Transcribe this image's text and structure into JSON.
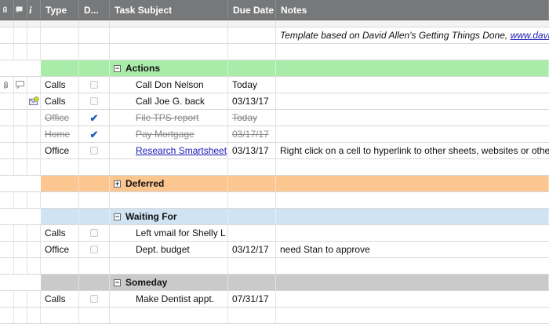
{
  "header": {
    "attachment_icon": "paperclip-icon",
    "comment_icon": "comment-icon",
    "info_label": "i",
    "type": "Type",
    "done": "D...",
    "subject": "Task Subject",
    "due": "Due Date",
    "notes": "Notes"
  },
  "intro_note": {
    "text": "Template based on David Allen's Getting Things Done, ",
    "link": "www.davidco."
  },
  "groups": {
    "actions": {
      "label": "Actions",
      "color": "#a9eba9",
      "toggle": "−"
    },
    "deferred": {
      "label": "Deferred",
      "color": "#fcc690",
      "toggle": "+"
    },
    "waiting": {
      "label": "Waiting For",
      "color": "#cfe3f3",
      "toggle": "−"
    },
    "someday": {
      "label": "Someday",
      "color": "#cacaca",
      "toggle": "−"
    }
  },
  "tasks": {
    "t1": {
      "type": "Calls",
      "subject": "Call Don Nelson",
      "due": "Today",
      "notes": ""
    },
    "t2": {
      "type": "Calls",
      "subject": "Call Joe G. back",
      "due": "03/13/17",
      "notes": ""
    },
    "t3": {
      "type": "Office",
      "subject": "File TPS report",
      "due": "Today",
      "notes": "",
      "done": true
    },
    "t4": {
      "type": "Home",
      "subject": "Pay Mortgage",
      "due": "03/17/17",
      "notes": "",
      "done": true
    },
    "t5": {
      "type": "Office",
      "subject": "Research Smartsheet",
      "due": "03/13/17",
      "notes": "Right click on a cell to hyperlink to other sheets, websites or other cell"
    },
    "t6": {
      "type": "Calls",
      "subject": "Left vmail for Shelly L",
      "due": "",
      "notes": ""
    },
    "t7": {
      "type": "Office",
      "subject": "Dept. budget",
      "due": "03/12/17",
      "notes": "need Stan to approve"
    },
    "t8": {
      "type": "Calls",
      "subject": "Make Dentist appt.",
      "due": "07/31/17",
      "notes": ""
    }
  },
  "icons": {
    "attachment": "paperclip-icon",
    "comment": "comment-icon",
    "reminder": "email-reminder-icon",
    "checkmark": "✔"
  }
}
